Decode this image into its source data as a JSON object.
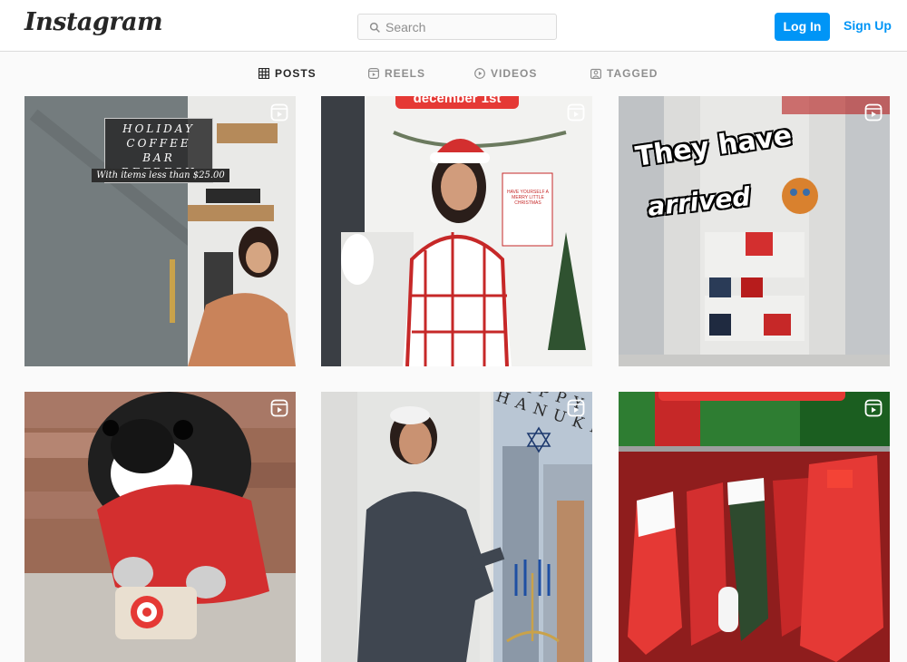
{
  "header": {
    "logo": "Instagram",
    "search_placeholder": "Search",
    "login_label": "Log In",
    "signup_label": "Sign Up"
  },
  "tabs": [
    {
      "label": "POSTS",
      "icon": "grid-icon",
      "active": true
    },
    {
      "label": "REELS",
      "icon": "reels-icon",
      "active": false
    },
    {
      "label": "VIDEOS",
      "icon": "play-icon",
      "active": false
    },
    {
      "label": "TAGGED",
      "icon": "tagged-icon",
      "active": false
    }
  ],
  "posts": [
    {
      "type": "reel",
      "overlay": [
        "HOLIDAY",
        "COFFEE BAR",
        "REFRESH"
      ],
      "subcaption": "With items less than $25.00"
    },
    {
      "type": "reel",
      "overlay": [
        "december 1st"
      ],
      "sign_text": "HAVE YOURSELF A MERRY LITTLE CHRISTMAS"
    },
    {
      "type": "reel",
      "overlay": [
        "They have",
        "arrived"
      ]
    },
    {
      "type": "reel",
      "overlay": []
    },
    {
      "type": "reel",
      "overlay": [
        "HAPPY HANUKKAH"
      ]
    },
    {
      "type": "reel",
      "overlay": []
    }
  ],
  "colors": {
    "accent": "#0095f6",
    "border": "#dbdbdb",
    "text_muted": "#8e8e8e",
    "text_dark": "#262626",
    "background": "#fafafa"
  }
}
